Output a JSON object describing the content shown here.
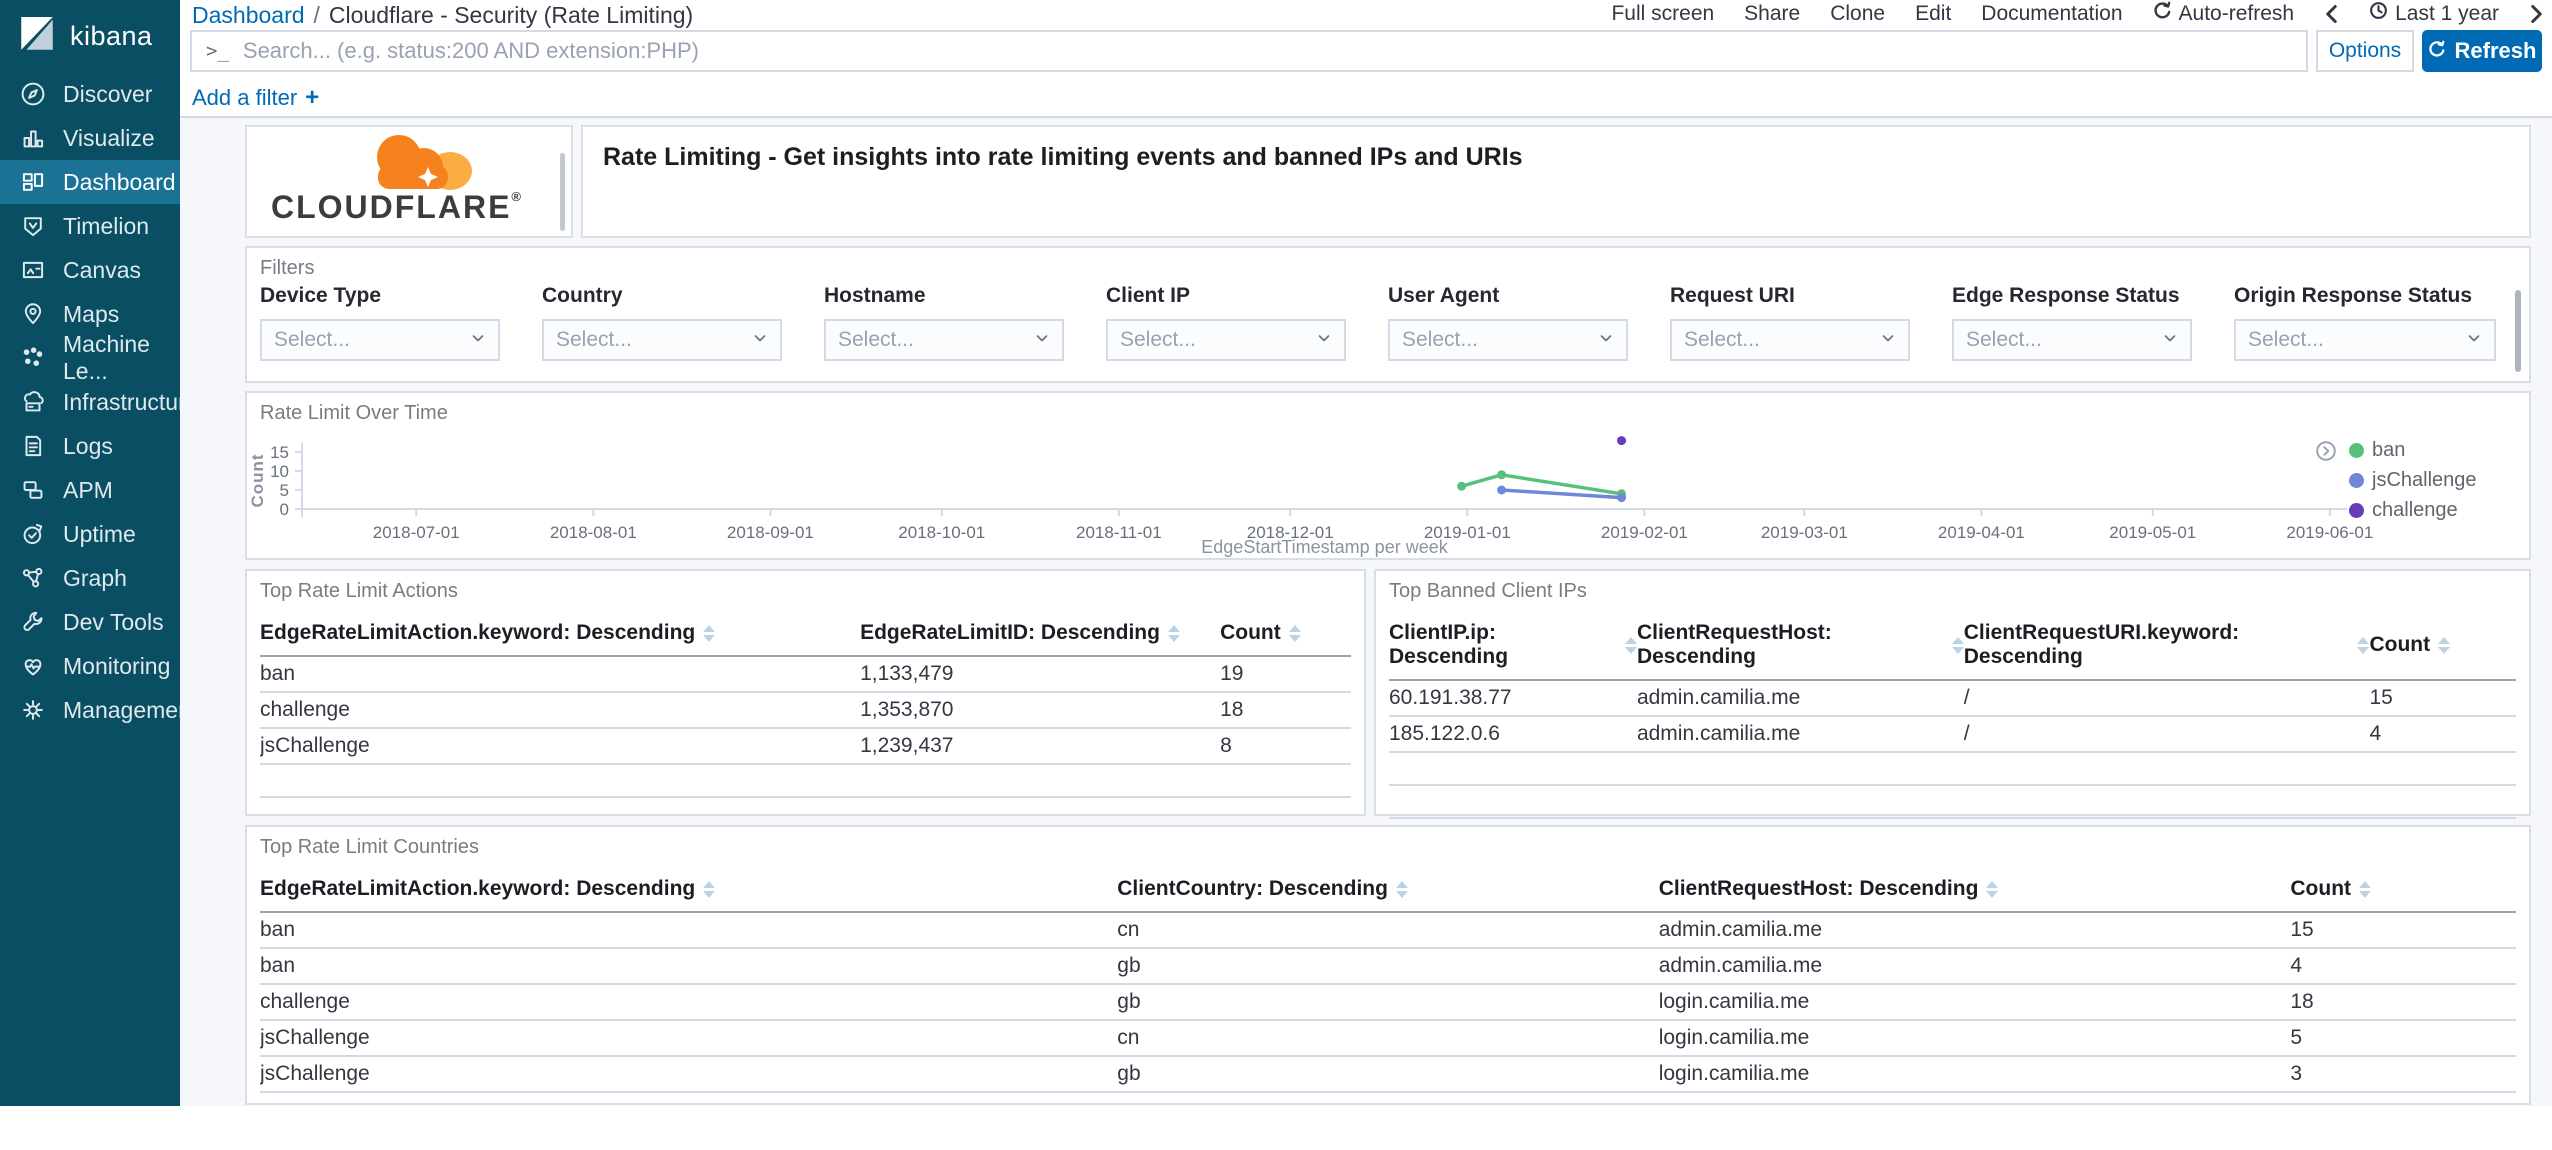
{
  "sidebar": {
    "logo_text": "kibana",
    "items": [
      {
        "label": "Discover",
        "icon": "compass-icon",
        "active": false
      },
      {
        "label": "Visualize",
        "icon": "visualize-icon",
        "active": false
      },
      {
        "label": "Dashboard",
        "icon": "dashboard-icon",
        "active": true
      },
      {
        "label": "Timelion",
        "icon": "timelion-icon",
        "active": false
      },
      {
        "label": "Canvas",
        "icon": "canvas-icon",
        "active": false
      },
      {
        "label": "Maps",
        "icon": "maps-icon",
        "active": false
      },
      {
        "label": "Machine Le...",
        "icon": "machine-learning-icon",
        "active": false
      },
      {
        "label": "Infrastructure",
        "icon": "infrastructure-icon",
        "active": false
      },
      {
        "label": "Logs",
        "icon": "logs-icon",
        "active": false
      },
      {
        "label": "APM",
        "icon": "apm-icon",
        "active": false
      },
      {
        "label": "Uptime",
        "icon": "uptime-icon",
        "active": false
      },
      {
        "label": "Graph",
        "icon": "graph-icon",
        "active": false
      },
      {
        "label": "Dev Tools",
        "icon": "dev-tools-icon",
        "active": false
      },
      {
        "label": "Monitoring",
        "icon": "monitoring-icon",
        "active": false
      },
      {
        "label": "Management",
        "icon": "management-icon",
        "active": false
      }
    ]
  },
  "header": {
    "breadcrumb": {
      "root": "Dashboard",
      "separator": "/",
      "current": "Cloudflare - Security (Rate Limiting)"
    },
    "menu": [
      "Full screen",
      "Share",
      "Clone",
      "Edit",
      "Documentation"
    ],
    "auto_refresh_label": "Auto-refresh",
    "time_range_label": "Last 1 year"
  },
  "query_bar": {
    "prompt": ">_",
    "placeholder": "Search... (e.g. status:200 AND extension:PHP)",
    "options_label": "Options",
    "refresh_label": "Refresh"
  },
  "filter_bar": {
    "add_filter_label": "Add a filter",
    "plus": "+"
  },
  "panels": {
    "branding": {
      "wordmark": "CLOUDFLARE",
      "registered": "®"
    },
    "description": {
      "title": "Rate Limiting - Get insights into rate limiting events and banned IPs and URIs"
    },
    "filters": {
      "title": "Filters",
      "select_placeholder": "Select...",
      "controls": [
        {
          "label": "Device Type",
          "placeholder": "Select..."
        },
        {
          "label": "Country",
          "placeholder": "Select..."
        },
        {
          "label": "Hostname",
          "placeholder": "Select..."
        },
        {
          "label": "Client IP",
          "placeholder": "Select..."
        },
        {
          "label": "User Agent",
          "placeholder": "Select..."
        },
        {
          "label": "Request URI",
          "placeholder": "Select..."
        },
        {
          "label": "Edge Response Status",
          "placeholder": "Select..."
        },
        {
          "label": "Origin Response Status",
          "placeholder": "Select..."
        }
      ]
    },
    "actions_table": {
      "title": "Top Rate Limit Actions",
      "headers": [
        "EdgeRateLimitAction.keyword: Descending",
        "EdgeRateLimitID: Descending",
        "Count"
      ],
      "rows": [
        [
          "ban",
          "1,133,479",
          "19"
        ],
        [
          "challenge",
          "1,353,870",
          "18"
        ],
        [
          "jsChallenge",
          "1,239,437",
          "8"
        ]
      ]
    },
    "banned_ips_table": {
      "title": "Top Banned Client IPs",
      "headers": [
        "ClientIP.ip: Descending",
        "ClientRequestHost: Descending",
        "ClientRequestURI.keyword: Descending",
        "Count"
      ],
      "rows": [
        [
          "60.191.38.77",
          "admin.camilia.me",
          "/",
          "15"
        ],
        [
          "185.122.0.6",
          "admin.camilia.me",
          "/",
          "4"
        ]
      ]
    },
    "countries_table": {
      "title": "Top Rate Limit Countries",
      "headers": [
        "EdgeRateLimitAction.keyword: Descending",
        "ClientCountry: Descending",
        "ClientRequestHost: Descending",
        "Count"
      ],
      "rows": [
        [
          "ban",
          "cn",
          "admin.camilia.me",
          "15"
        ],
        [
          "ban",
          "gb",
          "admin.camilia.me",
          "4"
        ],
        [
          "challenge",
          "gb",
          "login.camilia.me",
          "18"
        ],
        [
          "jsChallenge",
          "cn",
          "login.camilia.me",
          "5"
        ],
        [
          "jsChallenge",
          "gb",
          "login.camilia.me",
          "3"
        ]
      ]
    }
  },
  "chart_data": {
    "type": "line",
    "title": "Rate Limit Over Time",
    "xlabel": "EdgeStartTimestamp per week",
    "ylabel": "Count",
    "x_range": [
      "2018-06-11",
      "2019-06-04"
    ],
    "x_ticks": [
      "2018-07-01",
      "2018-08-01",
      "2018-09-01",
      "2018-10-01",
      "2018-11-01",
      "2018-12-01",
      "2019-01-01",
      "2019-02-01",
      "2019-03-01",
      "2019-04-01",
      "2019-05-01",
      "2019-06-01"
    ],
    "y_ticks": [
      0,
      5,
      10,
      15
    ],
    "ylim": [
      0,
      15
    ],
    "grid": false,
    "legend_position": "right",
    "series": [
      {
        "name": "ban",
        "color": "#57c17b",
        "points": [
          [
            "2018-12-31",
            6
          ],
          [
            "2019-01-07",
            9
          ],
          [
            "2019-01-28",
            4
          ]
        ]
      },
      {
        "name": "jsChallenge",
        "color": "#6f87d8",
        "points": [
          [
            "2019-01-07",
            5
          ],
          [
            "2019-01-28",
            3
          ]
        ]
      },
      {
        "name": "challenge",
        "color": "#663db8",
        "points": [
          [
            "2019-01-28",
            18
          ]
        ]
      }
    ]
  }
}
